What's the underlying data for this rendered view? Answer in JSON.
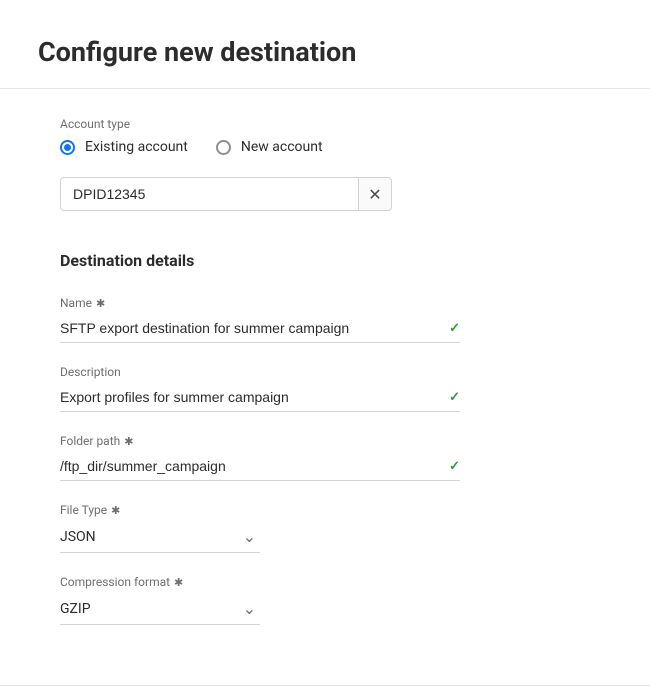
{
  "header": {
    "title": "Configure new destination"
  },
  "account_type": {
    "label": "Account type",
    "options": {
      "existing": "Existing account",
      "new": "New account"
    },
    "selected": "existing",
    "search_value": "DPID12345"
  },
  "destination_details": {
    "heading": "Destination details",
    "name": {
      "label": "Name",
      "value": "SFTP export destination for summer campaign",
      "valid": true
    },
    "description": {
      "label": "Description",
      "value": "Export profiles for summer campaign",
      "valid": true
    },
    "folder_path": {
      "label": "Folder path",
      "value": "/ftp_dir/summer_campaign",
      "valid": true
    },
    "file_type": {
      "label": "File Type",
      "value": "JSON"
    },
    "compression": {
      "label": "Compression format",
      "value": "GZIP"
    }
  },
  "glyphs": {
    "required": "✱",
    "check": "✓",
    "clear": "✕",
    "chevron": "⌄"
  }
}
